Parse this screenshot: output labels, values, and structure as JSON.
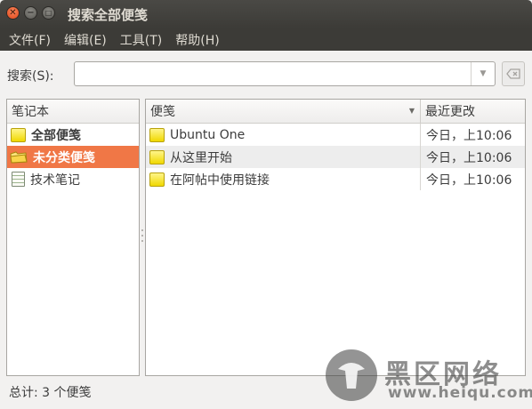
{
  "window": {
    "title": "搜索全部便笺"
  },
  "menubar": {
    "items": [
      "文件(F)",
      "编辑(E)",
      "工具(T)",
      "帮助(H)"
    ]
  },
  "search": {
    "label": "搜索(S):",
    "value": "",
    "placeholder": ""
  },
  "notebooks": {
    "header": "笔记本",
    "items": [
      {
        "label": "全部便笺",
        "icon": "note-stack-icon",
        "bold": true,
        "selected": false
      },
      {
        "label": "未分类便笺",
        "icon": "folder-icon",
        "bold": true,
        "selected": true
      },
      {
        "label": "技术笔记",
        "icon": "notepad-icon",
        "bold": false,
        "selected": false
      }
    ]
  },
  "notes": {
    "columns": [
      "便笺",
      "最近更改"
    ],
    "rows": [
      {
        "title": "Ubuntu One",
        "changed": "今日，上10:06"
      },
      {
        "title": "从这里开始",
        "changed": "今日，上10:06"
      },
      {
        "title": "在阿帖中使用链接",
        "changed": "今日，上10:06"
      }
    ]
  },
  "status": {
    "text": "总计: 3 个便笺"
  },
  "watermark": {
    "name": "黑区网络",
    "url": "www.heiqu.com"
  },
  "colors": {
    "selection": "#f07746",
    "titlebar": "#3c3b37",
    "close_button": "#e95420"
  }
}
